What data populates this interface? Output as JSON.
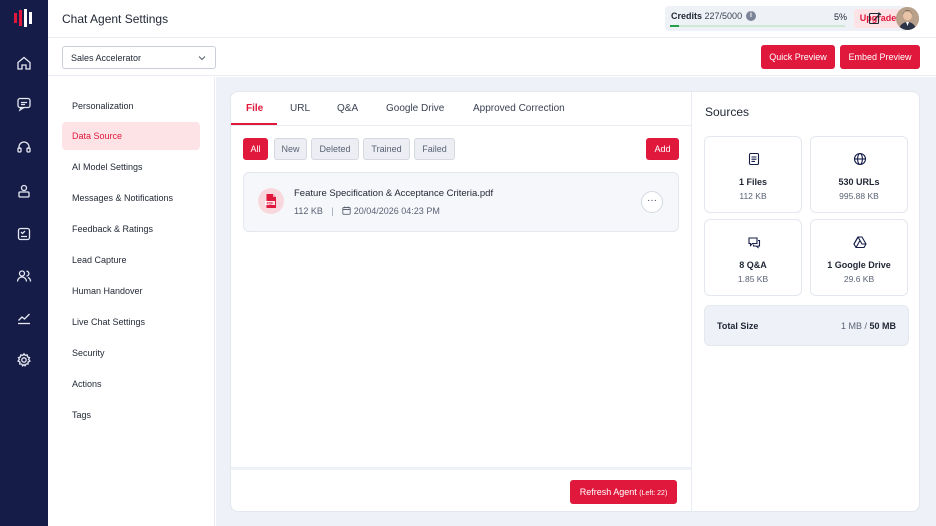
{
  "header": {
    "title": "Chat Agent Settings",
    "credits_label": "Credits",
    "credits_value": "227/5000",
    "credits_percent": "5%",
    "credits_progress": 0.05,
    "upgrade_label": "Upgrade"
  },
  "toolbar": {
    "agent_select_value": "Sales Accelerator",
    "quick_preview_label": "Quick Preview",
    "embed_preview_label": "Embed Preview"
  },
  "sidebar": {
    "icons": [
      "home-icon",
      "chat-icon",
      "headset-icon",
      "user-lock-icon",
      "checklist-icon",
      "users-icon",
      "analytics-icon",
      "settings-icon"
    ]
  },
  "settings_nav": {
    "items": [
      {
        "label": "Personalization"
      },
      {
        "label": "Data Source"
      },
      {
        "label": "AI Model Settings"
      },
      {
        "label": "Messages & Notifications"
      },
      {
        "label": "Feedback & Ratings"
      },
      {
        "label": "Lead Capture"
      },
      {
        "label": "Human Handover"
      },
      {
        "label": "Live Chat Settings"
      },
      {
        "label": "Security"
      },
      {
        "label": "Actions"
      },
      {
        "label": "Tags"
      }
    ],
    "active_index": 1
  },
  "data_source": {
    "tabs": [
      "File",
      "URL",
      "Q&A",
      "Google Drive",
      "Approved Correction"
    ],
    "filters": [
      "All",
      "New",
      "Deleted",
      "Trained",
      "Failed"
    ],
    "add_label": "Add",
    "file": {
      "name": "Feature Specification & Acceptance Criteria.pdf",
      "size": "112 KB",
      "separator": "|",
      "date": "20/04/2026 04:23 PM",
      "more_glyph": "···"
    },
    "refresh_label": "Refresh Agent",
    "refresh_left": "(Left: 22)"
  },
  "sources": {
    "title": "Sources",
    "cards": [
      {
        "icon": "document-icon",
        "name": "1 Files",
        "size": "112 KB"
      },
      {
        "icon": "globe-icon",
        "name": "530 URLs",
        "size": "995.88 KB"
      },
      {
        "icon": "qa-chat-icon",
        "name": "8 Q&A",
        "size": "1.85 KB"
      },
      {
        "icon": "google-drive-icon",
        "name": "1 Google Drive",
        "size": "29.6 KB"
      }
    ],
    "total_label": "Total Size",
    "total_used": "1 MB",
    "total_sep": " / ",
    "total_max": "50 MB"
  },
  "colors": {
    "accent": "#e0183c",
    "rail": "#141c47",
    "progress": "#22a04a"
  }
}
